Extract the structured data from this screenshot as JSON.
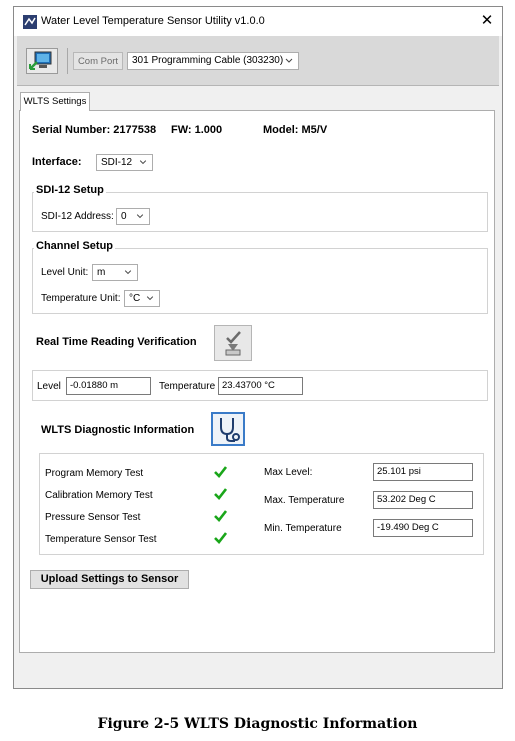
{
  "window": {
    "title": "Water Level Temperature Sensor Utility v1.0.0",
    "close_glyph": "✕"
  },
  "toolbar": {
    "connect_icon": "connect-device-icon",
    "com_port_label": "Com Port",
    "com_port_value": "301 Programming Cable (303230)"
  },
  "tab": {
    "label": "WLTS Settings"
  },
  "device": {
    "serial_number": "Serial Number: 2177538",
    "firmware": "FW: 1.000",
    "model": "Model: M5/V"
  },
  "interface": {
    "label": "Interface:",
    "value": "SDI-12"
  },
  "sdi12_setup": {
    "title": "SDI-12 Setup",
    "address_label": "SDI-12 Address:",
    "address_value": "0"
  },
  "channel_setup": {
    "title": "Channel Setup",
    "level_unit_label": "Level Unit:",
    "level_unit_value": "m",
    "temp_unit_label": "Temperature Unit:",
    "temp_unit_value": "°C"
  },
  "realtime": {
    "title": "Real Time Reading Verification",
    "button_icon": "checkmark-document-icon",
    "level_label": "Level",
    "level_value": "-0.01880 m",
    "temp_label": "Temperature",
    "temp_value": "23.43700 °C"
  },
  "diagnostics": {
    "title": "WLTS Diagnostic Information",
    "button_icon": "stethoscope-icon",
    "tests": [
      {
        "label": "Program Memory Test",
        "status": "pass"
      },
      {
        "label": "Calibration Memory Test",
        "status": "pass"
      },
      {
        "label": "Pressure Sensor Test",
        "status": "pass"
      },
      {
        "label": "Temperature Sensor Test",
        "status": "pass"
      }
    ],
    "max_level_label": "Max Level:",
    "max_level_value": "25.101 psi",
    "max_temp_label": "Max. Temperature",
    "max_temp_value": "53.202 Deg C",
    "min_temp_label": "Min. Temperature",
    "min_temp_value": "-19.490 Deg C"
  },
  "upload_button": "Upload Settings to Sensor",
  "caption": "Figure 2-5 WLTS Diagnostic Information",
  "colors": {
    "check_green": "#1aa61a",
    "icon_blue": "#1f5fa8",
    "toolbar_gray": "#d9d9d9"
  }
}
